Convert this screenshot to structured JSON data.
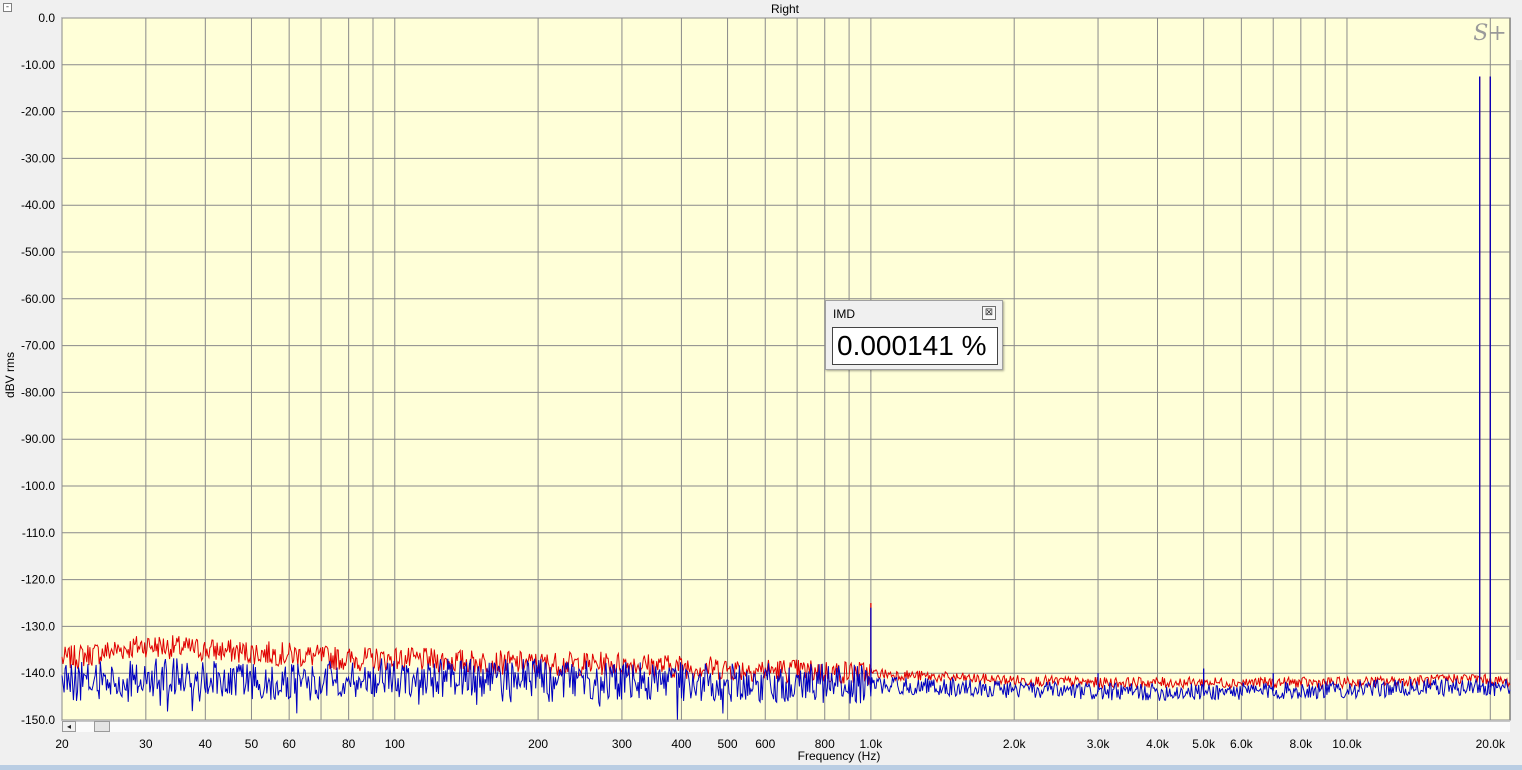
{
  "window": {
    "collapse_glyph": "-"
  },
  "imd_panel": {
    "title": "IMD",
    "value": "0.000141 %",
    "close_glyph": "⊠"
  },
  "logo": {
    "text": "S+"
  },
  "colors": {
    "plot_bg": "#ffffd8",
    "grid": "#8a8a8a",
    "red_series": "#e00000",
    "blue_series": "#0000c0"
  },
  "chart_data": {
    "type": "line",
    "title": "Right",
    "xlabel": "Frequency (Hz)",
    "ylabel": "dBV rms",
    "x_scale": "log",
    "xlim": [
      20,
      22000
    ],
    "ylim": [
      -150,
      0
    ],
    "y_ticks": [
      {
        "v": 0,
        "label": "0.0"
      },
      {
        "v": -10,
        "label": "-10.00"
      },
      {
        "v": -20,
        "label": "-20.00"
      },
      {
        "v": -30,
        "label": "-30.00"
      },
      {
        "v": -40,
        "label": "-40.00"
      },
      {
        "v": -50,
        "label": "-50.00"
      },
      {
        "v": -60,
        "label": "-60.00"
      },
      {
        "v": -70,
        "label": "-70.00"
      },
      {
        "v": -80,
        "label": "-80.00"
      },
      {
        "v": -90,
        "label": "-90.00"
      },
      {
        "v": -100,
        "label": "-100.0"
      },
      {
        "v": -110,
        "label": "-110.0"
      },
      {
        "v": -120,
        "label": "-120.0"
      },
      {
        "v": -130,
        "label": "-130.0"
      },
      {
        "v": -140,
        "label": "-140.0"
      },
      {
        "v": -150,
        "label": "-150.0"
      }
    ],
    "x_ticks": [
      {
        "v": 20,
        "label": "20"
      },
      {
        "v": 30,
        "label": "30"
      },
      {
        "v": 40,
        "label": "40"
      },
      {
        "v": 50,
        "label": "50"
      },
      {
        "v": 60,
        "label": "60"
      },
      {
        "v": 80,
        "label": "80"
      },
      {
        "v": 100,
        "label": "100"
      },
      {
        "v": 200,
        "label": "200"
      },
      {
        "v": 300,
        "label": "300"
      },
      {
        "v": 400,
        "label": "400"
      },
      {
        "v": 500,
        "label": "500"
      },
      {
        "v": 600,
        "label": "600"
      },
      {
        "v": 800,
        "label": "800"
      },
      {
        "v": 1000,
        "label": "1.0k"
      },
      {
        "v": 2000,
        "label": "2.0k"
      },
      {
        "v": 3000,
        "label": "3.0k"
      },
      {
        "v": 4000,
        "label": "4.0k"
      },
      {
        "v": 5000,
        "label": "5.0k"
      },
      {
        "v": 6000,
        "label": "6.0k"
      },
      {
        "v": 8000,
        "label": "8.0k"
      },
      {
        "v": 10000,
        "label": "10.0k"
      },
      {
        "v": 20000,
        "label": "20.0k"
      }
    ],
    "x_gridlines": [
      20,
      30,
      40,
      50,
      60,
      70,
      80,
      90,
      100,
      200,
      300,
      400,
      500,
      600,
      700,
      800,
      900,
      1000,
      2000,
      3000,
      4000,
      5000,
      6000,
      7000,
      8000,
      9000,
      10000,
      20000
    ],
    "grid": true,
    "series": [
      {
        "color": "#e00000",
        "points": [
          [
            20,
            -137
          ],
          [
            30,
            -134
          ],
          [
            40,
            -135
          ],
          [
            60,
            -136
          ],
          [
            80,
            -137
          ],
          [
            100,
            -137
          ],
          [
            200,
            -138
          ],
          [
            300,
            -138
          ],
          [
            500,
            -139
          ],
          [
            700,
            -139.5
          ],
          [
            1000,
            -140
          ],
          [
            1500,
            -141
          ],
          [
            2000,
            -141.5
          ],
          [
            3000,
            -142
          ],
          [
            5000,
            -142
          ],
          [
            10000,
            -142
          ],
          [
            15000,
            -141.5
          ],
          [
            18000,
            -141
          ],
          [
            19000,
            -12.5
          ],
          [
            20000,
            -12.5
          ],
          [
            22000,
            -142
          ]
        ],
        "spikes": [
          {
            "x": 1000,
            "y": -125
          },
          {
            "x": 19000,
            "y": -12.5
          },
          {
            "x": 20000,
            "y": -12.5
          }
        ]
      },
      {
        "color": "#0000c0",
        "points": [
          [
            20,
            -142
          ],
          [
            30,
            -141
          ],
          [
            40,
            -141
          ],
          [
            60,
            -142
          ],
          [
            80,
            -141
          ],
          [
            100,
            -141
          ],
          [
            200,
            -141
          ],
          [
            300,
            -141.5
          ],
          [
            500,
            -142
          ],
          [
            700,
            -142
          ],
          [
            1000,
            -142.5
          ],
          [
            1500,
            -143
          ],
          [
            2000,
            -143.5
          ],
          [
            3000,
            -144
          ],
          [
            5000,
            -144
          ],
          [
            10000,
            -143.5
          ],
          [
            15000,
            -143
          ],
          [
            18000,
            -143
          ],
          [
            19000,
            -12.5
          ],
          [
            20000,
            -12.5
          ],
          [
            22000,
            -143
          ]
        ],
        "spikes": [
          {
            "x": 1000,
            "y": -126
          },
          {
            "x": 3000,
            "y": -140
          },
          {
            "x": 5000,
            "y": -139
          },
          {
            "x": 7000,
            "y": -140
          },
          {
            "x": 19000,
            "y": -12.5
          },
          {
            "x": 20000,
            "y": -12.5
          }
        ]
      }
    ]
  }
}
